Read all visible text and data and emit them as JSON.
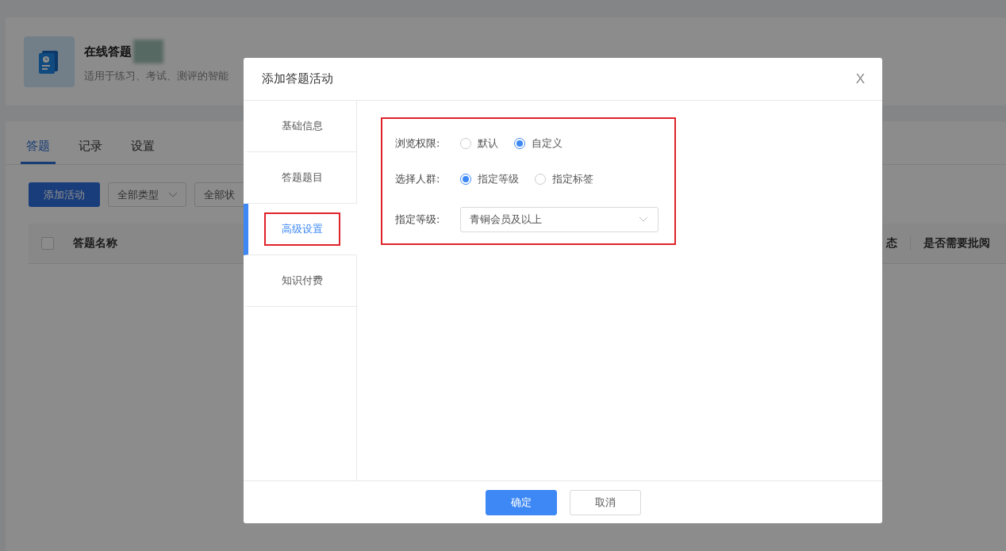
{
  "app_header": {
    "title": "在线答题",
    "description": "适用于练习、考试、测评的智能"
  },
  "tabs": [
    {
      "label": "答题",
      "selected": true
    },
    {
      "label": "记录",
      "selected": false
    },
    {
      "label": "设置",
      "selected": false
    }
  ],
  "toolbar": {
    "add_button": "添加活动",
    "filters": [
      {
        "label": "全部类型"
      },
      {
        "label": "全部状"
      }
    ]
  },
  "table": {
    "select_all": {
      "checked": false
    },
    "columns": [
      {
        "label": "答题名称"
      },
      {
        "label": "态"
      },
      {
        "label": "是否需要批阅"
      }
    ]
  },
  "dialog": {
    "title": "添加答题活动",
    "close": "X",
    "nav": [
      {
        "label": "基础信息",
        "selected": false,
        "annotated": false
      },
      {
        "label": "答题题目",
        "selected": false,
        "annotated": false
      },
      {
        "label": "高级设置",
        "selected": true,
        "annotated": true
      },
      {
        "label": "知识付费",
        "selected": false,
        "annotated": false
      }
    ],
    "form": {
      "annotated": true,
      "rows": [
        {
          "kind": "radio",
          "label": "浏览权限:",
          "options": [
            {
              "label": "默认",
              "selected": false
            },
            {
              "label": "自定义",
              "selected": true
            }
          ]
        },
        {
          "kind": "radio",
          "label": "选择人群:",
          "options": [
            {
              "label": "指定等级",
              "selected": true
            },
            {
              "label": "指定标签",
              "selected": false
            }
          ]
        },
        {
          "kind": "select",
          "label": "指定等级:",
          "value": "青铜会员及以上"
        }
      ]
    },
    "buttons": [
      {
        "label": "确定",
        "kind": "primary"
      },
      {
        "label": "取消",
        "kind": "default"
      }
    ]
  }
}
